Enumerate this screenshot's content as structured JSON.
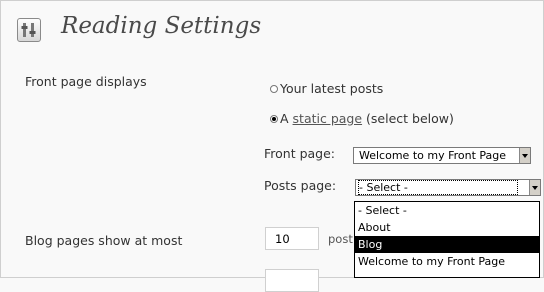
{
  "page": {
    "title": "Reading Settings"
  },
  "front_page_displays": {
    "label": "Front page displays",
    "option_latest": "Your latest posts",
    "option_static_prefix": "A",
    "option_static_link": "static page",
    "option_static_suffix": "(select below)",
    "selected": "static"
  },
  "front_page_select": {
    "label": "Front page:",
    "value": "Welcome to my Front Page"
  },
  "posts_page_select": {
    "label": "Posts page:",
    "value": "- Select -",
    "options": [
      "- Select -",
      "About",
      "Blog",
      "Welcome to my Front Page"
    ],
    "highlighted": "Blog"
  },
  "blog_pages": {
    "label": "Blog pages show at most",
    "value": "10",
    "suffix": "post"
  }
}
